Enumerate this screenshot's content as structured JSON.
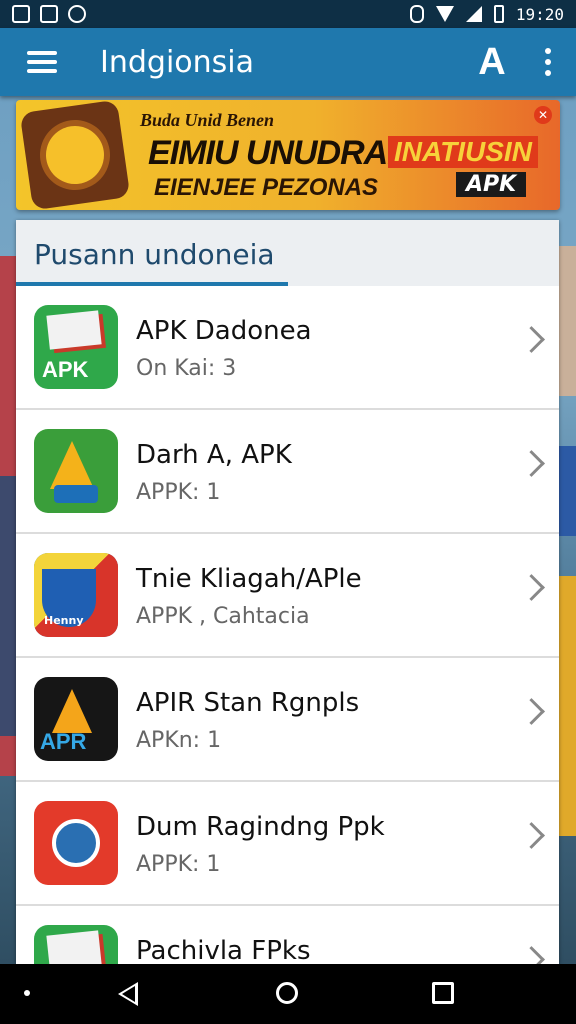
{
  "status_bar": {
    "time": "19:20"
  },
  "app_bar": {
    "title": "Indgionsia",
    "logo_glyph": "A"
  },
  "banner": {
    "small_text": "Buda Unid Benen",
    "main_text": "EIMIU UNUDRAN3",
    "badge_text": "INATIUSIN",
    "sub_text": "EIENJEE PEZONAS",
    "apk_label": "APK"
  },
  "section": {
    "title": "Pusann undoneia"
  },
  "apps": [
    {
      "name": "APK Dadonea",
      "sub": "On Kai:  3",
      "icon": "books-icon",
      "style": "icon-green",
      "icon_text": "APK"
    },
    {
      "name": "Darh A, APK",
      "sub": "APPK:  1",
      "icon": "triangle-icon",
      "style": "icon-multi",
      "icon_text": ""
    },
    {
      "name": "Tnie Kliagah/APle",
      "sub": "APPK , Cahtacia",
      "icon": "shield-icon",
      "style": "icon-blue",
      "icon_text": "Henny"
    },
    {
      "name": "APIR Stan Rgnpls",
      "sub": "APKn:  1",
      "icon": "apk-key-icon",
      "style": "icon-dark",
      "icon_text": "APR"
    },
    {
      "name": "Dum Ragindng Ppk",
      "sub": "APPK:  1",
      "icon": "globe-icon",
      "style": "icon-red",
      "icon_text": ""
    },
    {
      "name": "Pachivla FPks",
      "sub": "",
      "icon": "books-icon",
      "style": "icon-green",
      "icon_text": ""
    }
  ],
  "colors": {
    "app_bar": "#1f78ad",
    "status_bar": "#0e2f45",
    "accent": "#1f78ad"
  }
}
